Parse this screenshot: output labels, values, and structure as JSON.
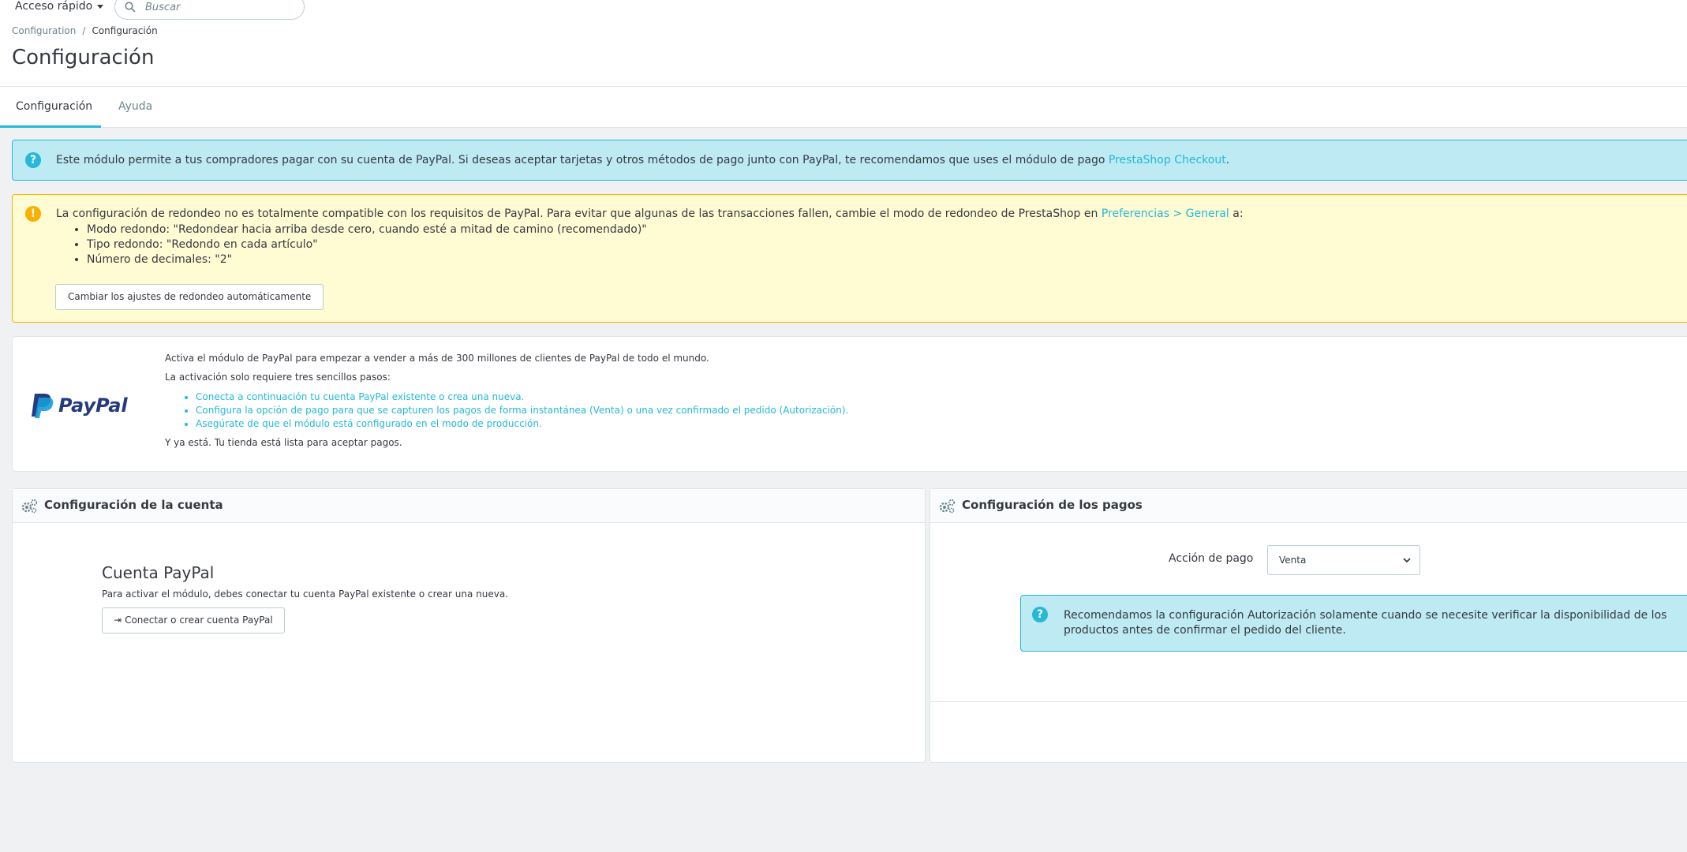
{
  "header": {
    "quick_access": "Acceso rápido",
    "search_placeholder": "Buscar"
  },
  "breadcrumb": {
    "parent": "Configuration",
    "separator": "/",
    "current": "Configuración"
  },
  "page_title": "Configuración",
  "tabs": [
    {
      "label": "Configuración",
      "active": true
    },
    {
      "label": "Ayuda",
      "active": false
    }
  ],
  "info_alert": {
    "text": "Este módulo permite a tus compradores pagar con su cuenta de PayPal. Si deseas aceptar tarjetas y otros métodos de pago junto con PayPal, te recomendamos que uses el módulo de pago ",
    "link": "PrestaShop Checkout",
    "suffix": "."
  },
  "warning_alert": {
    "text": "La configuración de redondeo no es totalmente compatible con los requisitos de PayPal. Para evitar que algunas de las transacciones fallen, cambie el modo de redondeo de PrestaShop en ",
    "link": "Preferencias > General",
    "suffix": " a:",
    "items": [
      "Modo redondo: \"Redondear hacia arriba desde cero, cuando esté a mitad de camino (recomendado)\"",
      "Tipo redondo: \"Redondo en cada artículo\"",
      "Número de decimales: \"2\""
    ],
    "button": "Cambiar los ajustes de redondeo automáticamente"
  },
  "paypal_panel": {
    "logo_text": "PayPal",
    "intro": "Activa el módulo de PayPal para empezar a vender a más de 300 millones de clientes de PayPal de todo el mundo.",
    "steps_title": "La activación solo requiere tres sencillos pasos:",
    "steps": [
      "Conecta a continuación tu cuenta PayPal existente o crea una nueva.",
      "Configura la opción de pago para que se capturen los pagos de forma instantánea (Venta) o una vez confirmado el pedido (Autorización).",
      "Asegúrate de que el módulo está configurado en el modo de producción."
    ],
    "outro": "Y ya está. Tu tienda está lista para aceptar pagos."
  },
  "account_panel": {
    "heading": "Configuración de la cuenta",
    "title": "Cuenta PayPal",
    "description": "Para activar el módulo, debes conectar tu cuenta PayPal existente o crear una nueva.",
    "button": "Conectar o crear cuenta PayPal"
  },
  "payments_panel": {
    "heading": "Configuración de los pagos",
    "action_label": "Acción de pago",
    "action_value": "Venta",
    "info_text": "Recomendamos la configuración Autorización solamente cuando se necesite verificar la disponibilidad de los productos antes de confirmar el pedido del cliente."
  },
  "colors": {
    "accent": "#25b9d7",
    "info_bg": "#bdeaf3",
    "warning_bg": "#fffbd3",
    "warning_border": "#fab000",
    "paypal_dark": "#253b80",
    "paypal_light": "#179bd7"
  },
  "icons": [
    "search-icon",
    "caret-down-icon",
    "help-icon",
    "warning-icon",
    "cogs-icon",
    "sign-in-icon",
    "chevron-down-icon"
  ]
}
